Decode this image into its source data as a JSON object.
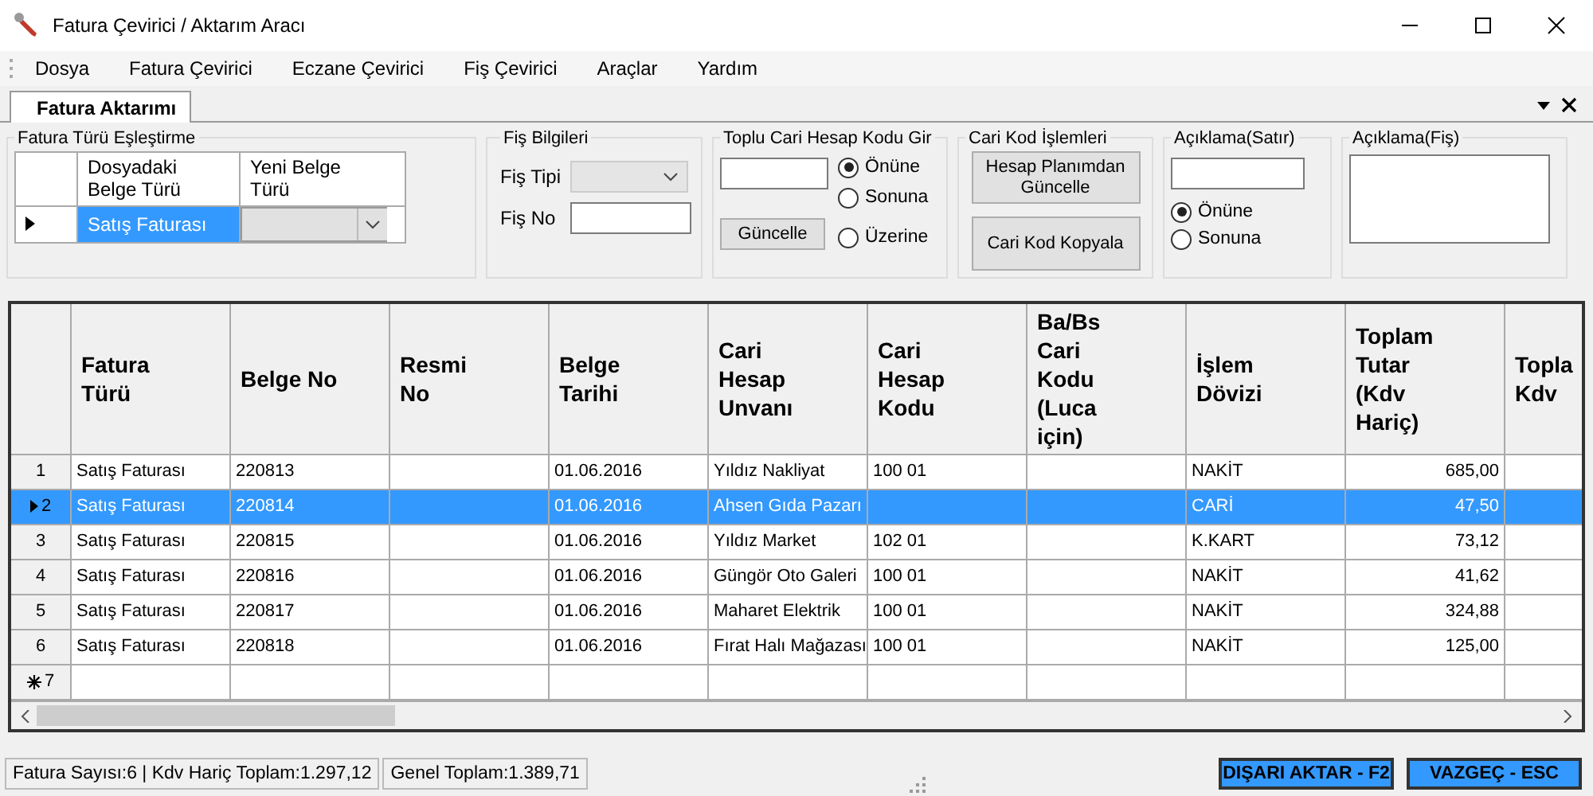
{
  "window": {
    "title": "Fatura Çevirici / Aktarım Aracı"
  },
  "menu": [
    "Dosya",
    "Fatura Çevirici",
    "Eczane Çevirici",
    "Fiş Çevirici",
    "Araçlar",
    "Yardım"
  ],
  "tabs": [
    {
      "label": "Fatura Aktarımı",
      "selected": true
    }
  ],
  "type_mapping": {
    "title": "Fatura Türü Eşleştirme",
    "columns": [
      "Dosyadaki\nBelge Türü",
      "Yeni Belge\nTürü"
    ],
    "rows": [
      {
        "source": "Satış Faturası",
        "selected": true
      }
    ]
  },
  "receipt_info": {
    "title": "Fiş Bilgileri",
    "type_label": "Fiş Tipi",
    "no_label": "Fiş No"
  },
  "bulk_code": {
    "title": "Toplu Cari Hesap Kodu Gir",
    "button": "Güncelle",
    "options": [
      {
        "label": "Önüne",
        "selected": true
      },
      {
        "label": "Sonuna",
        "selected": false
      },
      {
        "label": "Üzerine",
        "selected": false
      }
    ]
  },
  "code_ops": {
    "title": "Cari Kod İşlemleri",
    "buttons": [
      "Hesap Planımdan\nGüncelle",
      "Cari Kod Kopyala"
    ]
  },
  "line_note": {
    "title": "Açıklama(Satır)",
    "options": [
      {
        "label": "Önüne",
        "selected": true
      },
      {
        "label": "Sonuna",
        "selected": false
      }
    ]
  },
  "receipt_note": {
    "title": "Açıklama(Fiş)"
  },
  "table": {
    "columns": [
      {
        "label": "Fatura\nTürü"
      },
      {
        "label": "Belge No"
      },
      {
        "label": "Resmi\nNo"
      },
      {
        "label": "Belge\nTarihi"
      },
      {
        "label": "Cari\nHesap\nUnvanı"
      },
      {
        "label": "Cari\nHesap\nKodu"
      },
      {
        "label": "Ba/Bs\nCari\nKodu\n(Luca\niçin)"
      },
      {
        "label": "İşlem\nDövizi"
      },
      {
        "label": "Toplam\nTutar\n(Kdv\nHariç)",
        "kind": "number"
      },
      {
        "label": "Topla\nKdv"
      }
    ],
    "rows": [
      {
        "number": "1",
        "selected": false,
        "cells": [
          "Satış Faturası",
          "220813",
          null,
          "01.06.2016",
          "Yıldız Nakliyat",
          "100 01",
          null,
          "NAKİT",
          "685,00"
        ]
      },
      {
        "number": "2",
        "selected": true,
        "cells": [
          "Satış Faturası",
          "220814",
          null,
          "01.06.2016",
          "Ahsen Gıda Pazarı",
          null,
          null,
          "CARİ",
          "47,50"
        ]
      },
      {
        "number": "3",
        "selected": false,
        "cells": [
          "Satış Faturası",
          "220815",
          null,
          "01.06.2016",
          "Yıldız Market",
          "102 01",
          null,
          "K.KART",
          "73,12"
        ]
      },
      {
        "number": "4",
        "selected": false,
        "cells": [
          "Satış Faturası",
          "220816",
          null,
          "01.06.2016",
          "Güngör Oto Galeri",
          "100 01",
          null,
          "NAKİT",
          "41,62"
        ]
      },
      {
        "number": "5",
        "selected": false,
        "cells": [
          "Satış Faturası",
          "220817",
          null,
          "01.06.2016",
          "Maharet Elektrik",
          "100 01",
          null,
          "NAKİT",
          "324,88"
        ]
      },
      {
        "number": "6",
        "selected": false,
        "cells": [
          "Satış Faturası",
          "220818",
          null,
          "01.06.2016",
          "Fırat Halı Mağazası",
          "100 01",
          null,
          "NAKİT",
          "125,00"
        ]
      }
    ],
    "new_row": {
      "number": "7"
    }
  },
  "status_bar": {
    "items": [
      "Fatura Sayısı:6 | Kdv Hariç Toplam:1.297,12",
      "Genel Toplam:1.389,71"
    ]
  },
  "buttons": [
    "DIŞARI AKTAR - F2",
    "VAZGEÇ - ESC"
  ]
}
